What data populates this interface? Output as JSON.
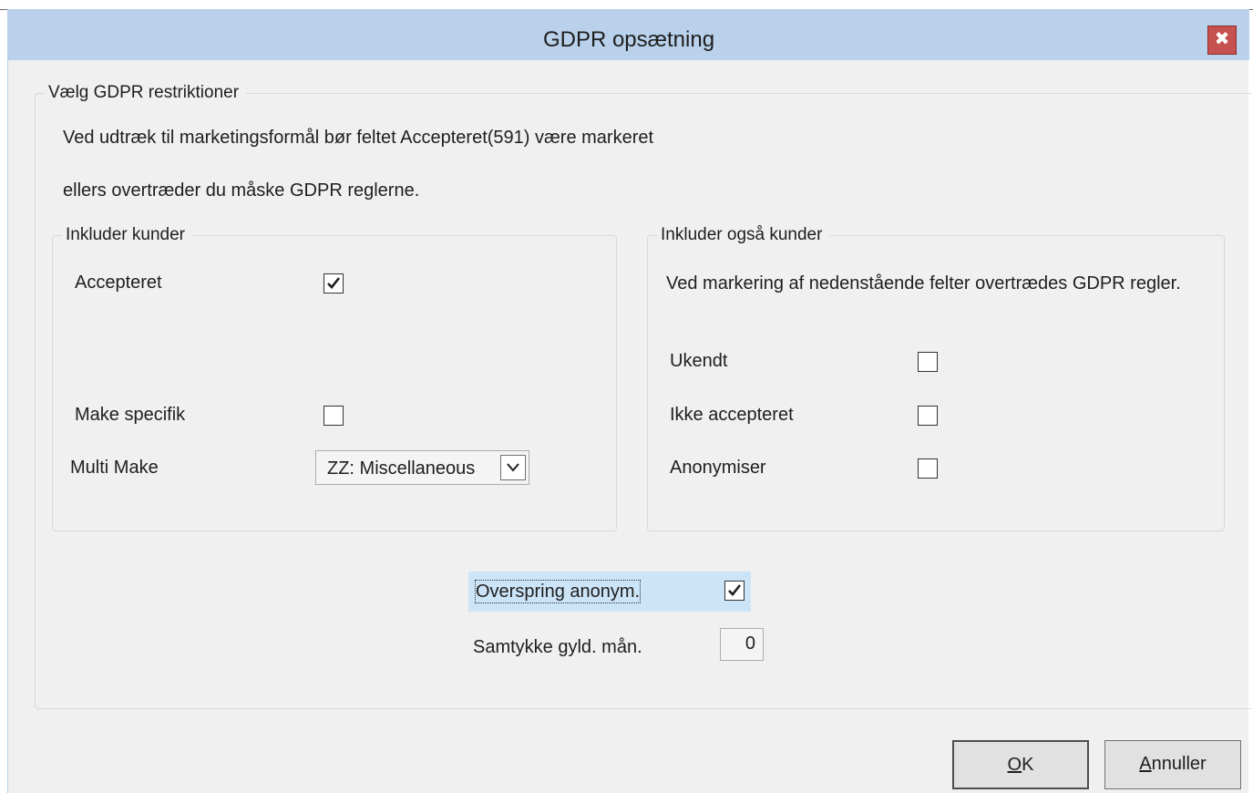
{
  "window": {
    "title": "GDPR opsætning",
    "close_glyph": "✖"
  },
  "restrictions": {
    "title": "Vælg GDPR restriktioner",
    "info_line1": "Ved udtræk til marketingsformål bør feltet Accepteret(591) være markeret",
    "info_line2": "ellers overtræder du måske GDPR reglerne."
  },
  "include_customers": {
    "title": "Inkluder kunder",
    "accepted_label": "Accepteret",
    "accepted_checked": true,
    "make_specific_label": "Make specifik",
    "make_specific_checked": false,
    "multi_make_label": "Multi Make",
    "multi_make_value": "ZZ: Miscellaneous"
  },
  "include_also": {
    "title": "Inkluder også kunder",
    "warning": "Ved markering af nedenstående felter overtrædes GDPR regler.",
    "unknown_label": "Ukendt",
    "unknown_checked": false,
    "not_accepted_label": "Ikke accepteret",
    "not_accepted_checked": false,
    "anonymize_label": "Anonymiser",
    "anonymize_checked": false
  },
  "skip_anonymous": {
    "label": "Overspring anonym.",
    "checked": true
  },
  "consent_months": {
    "label": "Samtykke gyld. mån.",
    "value": "0"
  },
  "buttons": {
    "ok_label": "OK",
    "cancel_label": "Annuller"
  },
  "icons": {
    "close": "close-icon",
    "check": "checkmark-icon",
    "dropdown": "chevron-down-icon"
  }
}
